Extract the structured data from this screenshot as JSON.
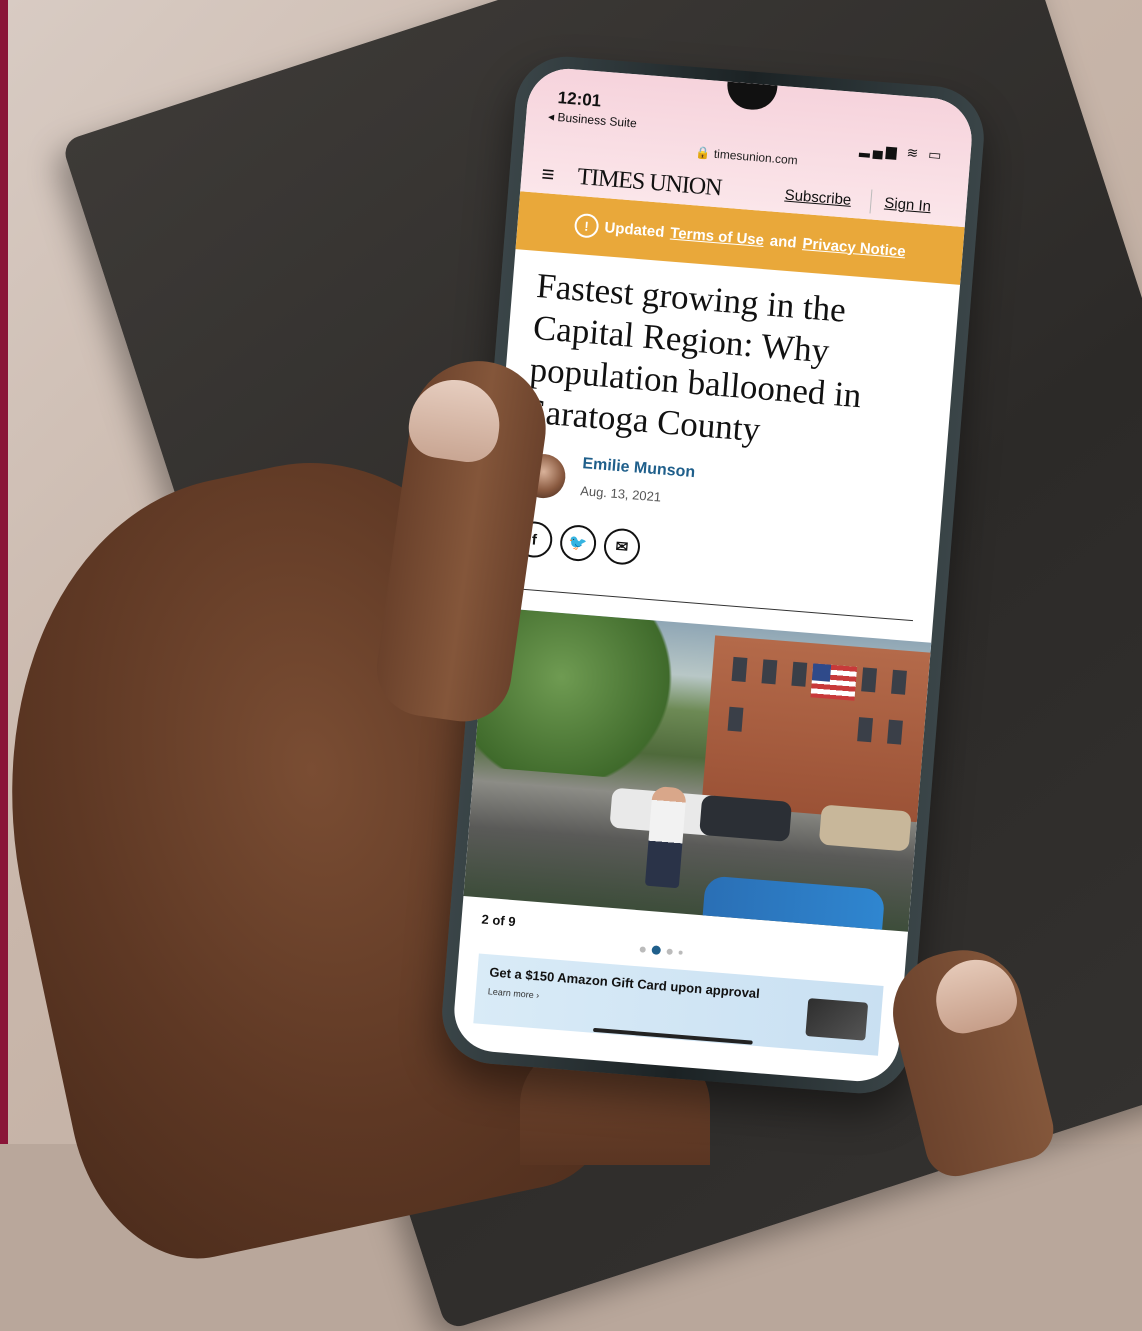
{
  "status_bar": {
    "time": "12:01",
    "back_app": "◂ Business Suite",
    "url": "🔒 timesunion.com",
    "icons": "▂▄▆ ≋ ▭"
  },
  "masthead": {
    "menu_icon": "≡",
    "logo": "TIMES UNION",
    "subscribe": "Subscribe",
    "sign_in": "Sign In"
  },
  "notice": {
    "icon": "!",
    "prefix": "Updated",
    "terms": "Terms of Use",
    "conj": "and",
    "privacy": "Privacy Notice"
  },
  "article": {
    "headline": "Fastest growing in the Capital Region: Why population ballooned in Saratoga County",
    "author": "Emilie Munson",
    "date": "Aug. 13, 2021"
  },
  "social": {
    "facebook": "f",
    "twitter": "🐦",
    "email": "✉"
  },
  "gallery": {
    "count": "2 of 9"
  },
  "ad": {
    "title": "Get a $150 Amazon Gift Card upon approval",
    "sub": "Learn more ›"
  }
}
